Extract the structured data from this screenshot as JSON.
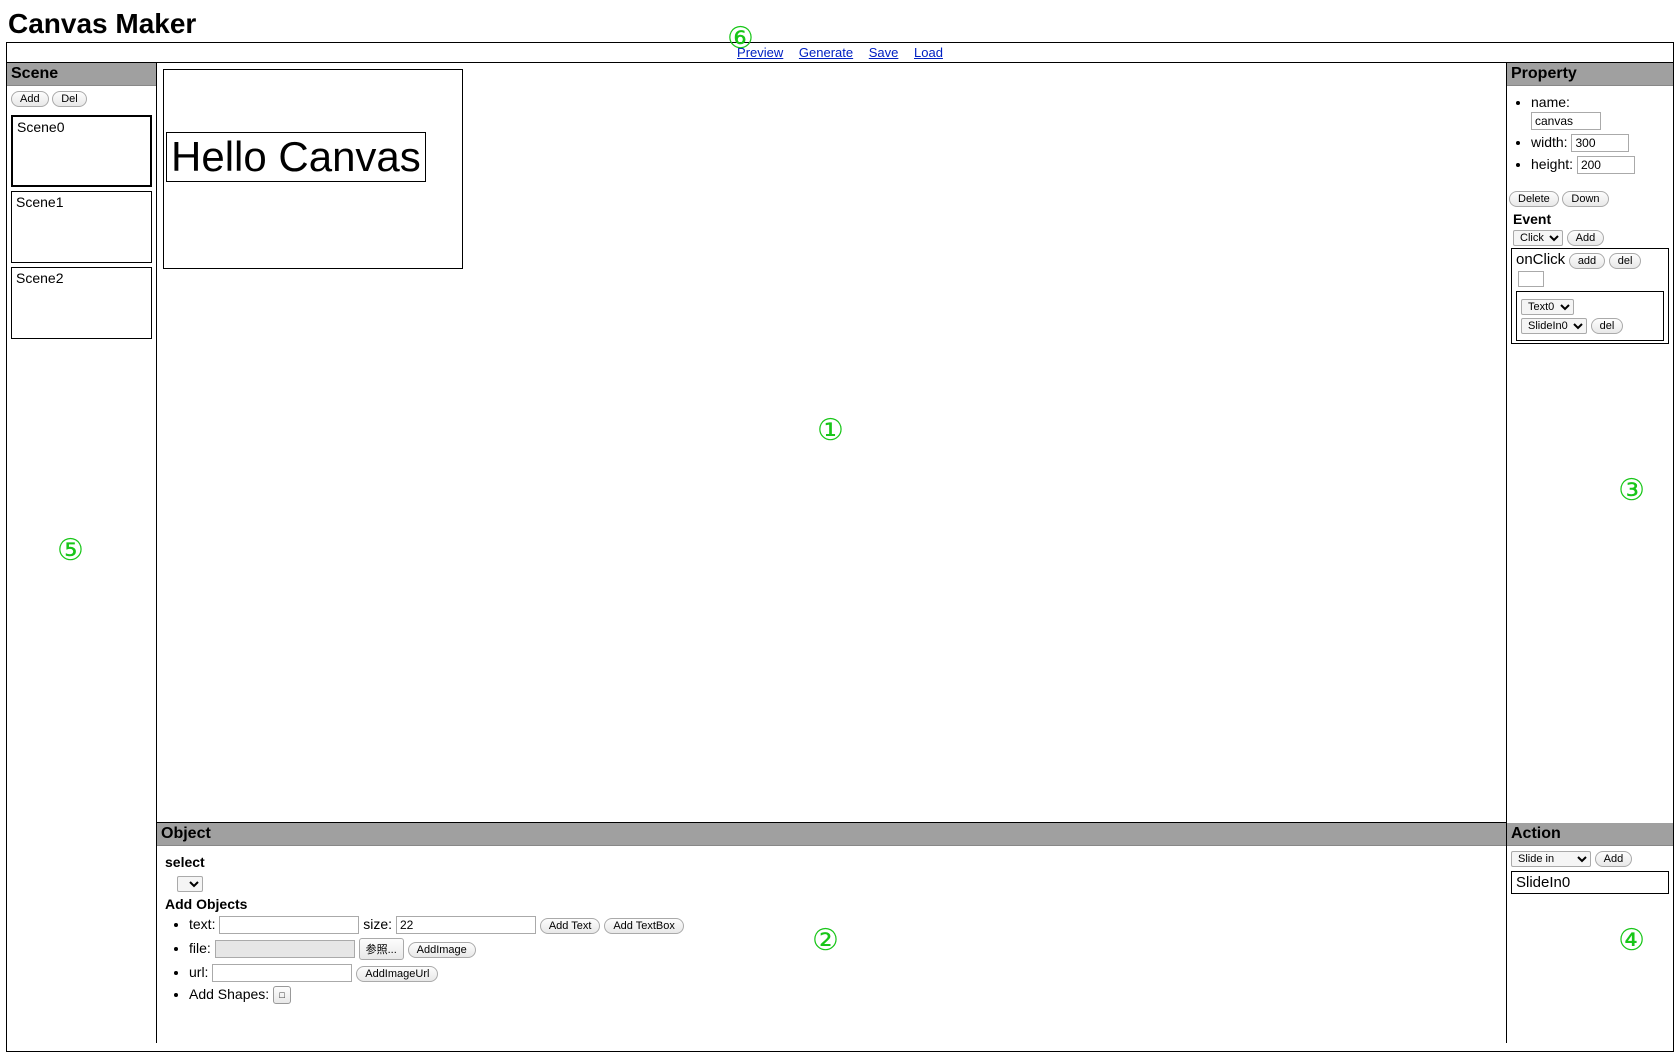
{
  "title": "Canvas Maker",
  "toolbar": {
    "preview": "Preview",
    "generate": "Generate",
    "save": "Save",
    "load": "Load"
  },
  "scene": {
    "header": "Scene",
    "add": "Add",
    "del": "Del",
    "items": [
      "Scene0",
      "Scene1",
      "Scene2"
    ],
    "selected": 0
  },
  "canvas": {
    "hello_text": "Hello Canvas"
  },
  "property": {
    "header": "Property",
    "name_label": "name:",
    "name_value": "canvas",
    "width_label": "width:",
    "width_value": "300",
    "height_label": "height:",
    "height_value": "200",
    "delete": "Delete",
    "down": "Down",
    "event_header": "Event",
    "event_type": "Click",
    "event_add": "Add",
    "onclick_label": "onClick",
    "onclick_add": "add",
    "onclick_del": "del",
    "target_sel": "Text0",
    "action_sel": "SlideIn0",
    "action_del": "del"
  },
  "object": {
    "header": "Object",
    "select_label": "select",
    "add_header": "Add Objects",
    "text_label": "text:",
    "size_label": "size:",
    "size_value": "22",
    "add_text": "Add Text",
    "add_textbox": "Add TextBox",
    "file_label": "file:",
    "browse": "参照...",
    "add_image": "AddImage",
    "url_label": "url:",
    "add_image_url": "AddImageUrl",
    "shapes_label": "Add Shapes:",
    "shape_glyph": "□"
  },
  "action": {
    "header": "Action",
    "type": "Slide in",
    "add": "Add",
    "item": "SlideIn0"
  },
  "markers": {
    "m1": "①",
    "m2": "②",
    "m3": "③",
    "m4": "④",
    "m5": "⑤",
    "m6": "⑥"
  }
}
